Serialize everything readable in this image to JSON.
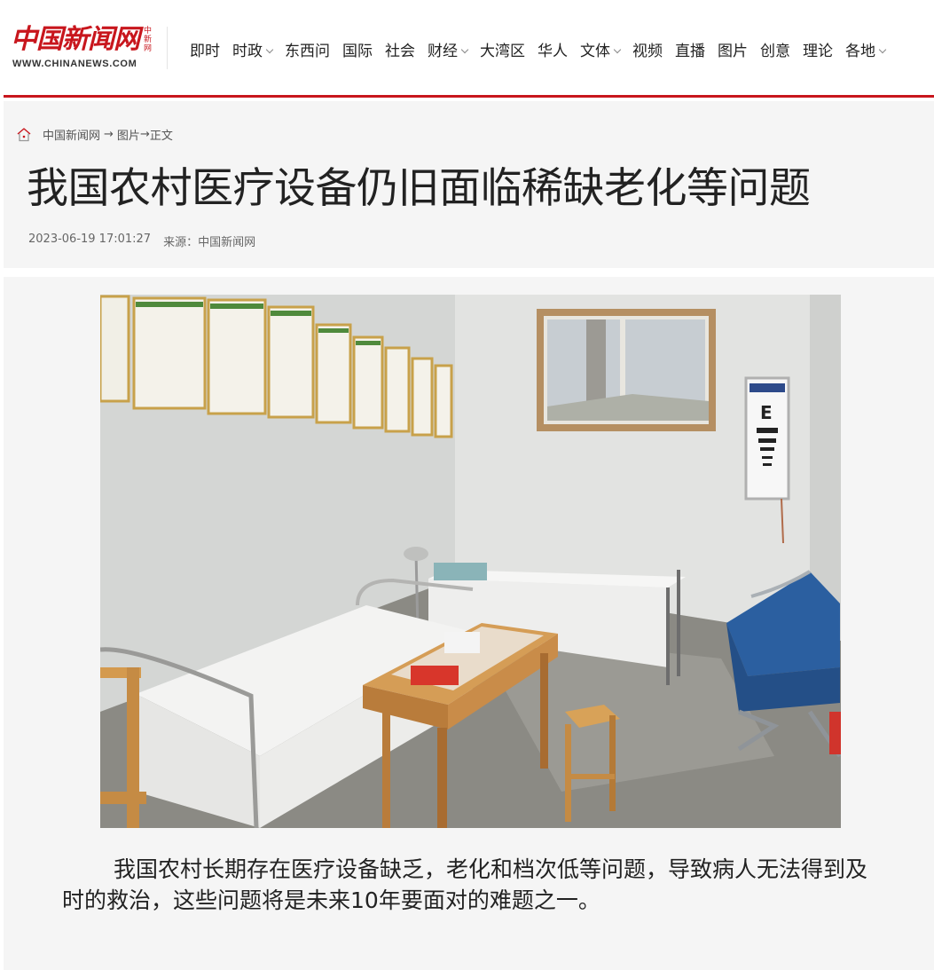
{
  "site": {
    "logo_text": "中国新闻网",
    "logo_side": "中新网",
    "logo_url": "WWW.CHINANEWS.COM"
  },
  "nav": [
    {
      "label": "即时",
      "dropdown": false
    },
    {
      "label": "时政",
      "dropdown": true
    },
    {
      "label": "东西问",
      "dropdown": false
    },
    {
      "label": "国际",
      "dropdown": false
    },
    {
      "label": "社会",
      "dropdown": false
    },
    {
      "label": "财经",
      "dropdown": true
    },
    {
      "label": "大湾区",
      "dropdown": false
    },
    {
      "label": "华人",
      "dropdown": false
    },
    {
      "label": "文体",
      "dropdown": true
    },
    {
      "label": "视频",
      "dropdown": false
    },
    {
      "label": "直播",
      "dropdown": false
    },
    {
      "label": "图片",
      "dropdown": false
    },
    {
      "label": "创意",
      "dropdown": false
    },
    {
      "label": "理论",
      "dropdown": false
    },
    {
      "label": "各地",
      "dropdown": true
    }
  ],
  "breadcrumb": {
    "home": "中国新闻网",
    "sep1": "→",
    "section": "图片",
    "sep2": "→",
    "current": "正文"
  },
  "article": {
    "title": "我国农村医疗设备仍旧面临稀缺老化等问题",
    "datetime": "2023-06-19 17:01:27",
    "source_label": "来源：",
    "source": "中国新闻网",
    "caption": "我国农村长期存在医疗设备缺乏，老化和档次低等问题，导致病人无法得到及时的救治，这些问题将是未来10年要面对的难题之一。"
  },
  "colors": {
    "brand_red": "#c8161d",
    "panel_bg": "#f5f5f5"
  },
  "icons": {
    "home": "home-icon",
    "nav_dropdown": "chevron-down-icon"
  },
  "photo_content": {
    "eye_chart_letter": "E"
  }
}
